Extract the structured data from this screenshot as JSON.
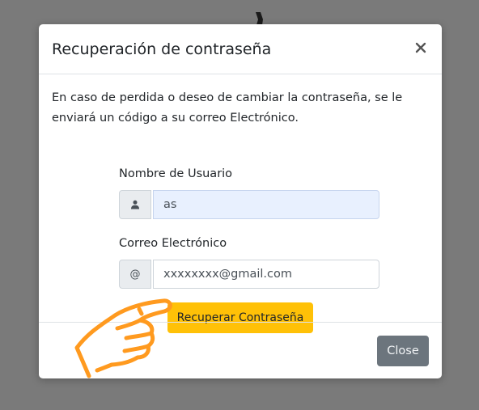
{
  "modal": {
    "title": "Recuperación de contraseña",
    "intro": "En caso de perdida o deseo de cambiar la contraseña, se le enviará un código a su correo Electrónico.",
    "username_label": "Nombre de Usuario",
    "username_value": "as",
    "email_label": "Correo Electrónico",
    "email_addon": "@",
    "email_value": "xxxxxxxx@gmail.com",
    "submit_label": "Recuperar Contraseña",
    "close_label": "Close"
  },
  "icons": {
    "close": "close-icon",
    "user": "user-icon",
    "pointer": "pointing-hand-icon"
  },
  "colors": {
    "backdrop": "#7a7a7a",
    "primary_button": "#ffc107",
    "secondary_button": "#6c757d",
    "hand_outline": "#ff9a1f",
    "autofill_field": "#e8f0fe"
  }
}
